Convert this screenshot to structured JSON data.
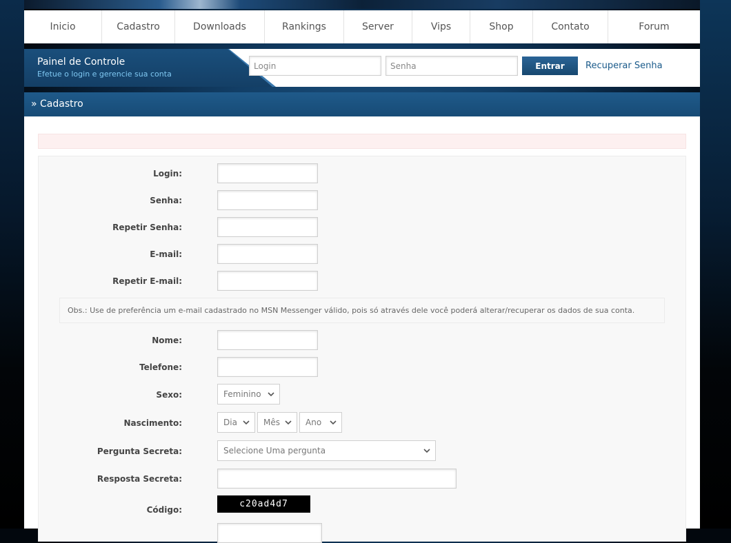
{
  "nav": {
    "items": [
      {
        "label": "Inicio"
      },
      {
        "label": "Cadastro"
      },
      {
        "label": "Downloads"
      },
      {
        "label": "Rankings"
      },
      {
        "label": "Server"
      },
      {
        "label": "Vips"
      },
      {
        "label": "Shop"
      },
      {
        "label": "Contato"
      },
      {
        "label": "Forum"
      }
    ]
  },
  "panel": {
    "title": "Painel de Controle",
    "subtitle": "Efetue o login e gerencie sua conta",
    "login_placeholder": "Login",
    "password_placeholder": "Senha",
    "submit_label": "Entrar",
    "recover_label": "Recuperar Senha"
  },
  "section": {
    "title": "» Cadastro"
  },
  "form": {
    "labels": {
      "login": "Login:",
      "password": "Senha:",
      "password_repeat": "Repetir Senha:",
      "email": "E-mail:",
      "email_repeat": "Repetir E-mail:",
      "name": "Nome:",
      "phone": "Telefone:",
      "gender": "Sexo:",
      "birth": "Nascimento:",
      "question": "Pergunta Secreta:",
      "answer": "Resposta Secreta:",
      "code": "Código:"
    },
    "note": "Obs.: Use de preferência um e-mail cadastrado no MSN Messenger válido, pois só através dele você poderá alterar/recuperar os dados de sua conta.",
    "gender_value": "Feminino",
    "birth_day": "Dia",
    "birth_month": "Mês",
    "birth_year": "Ano",
    "question_value": "Selecione Uma pergunta",
    "captcha": "c20ad4d7"
  }
}
